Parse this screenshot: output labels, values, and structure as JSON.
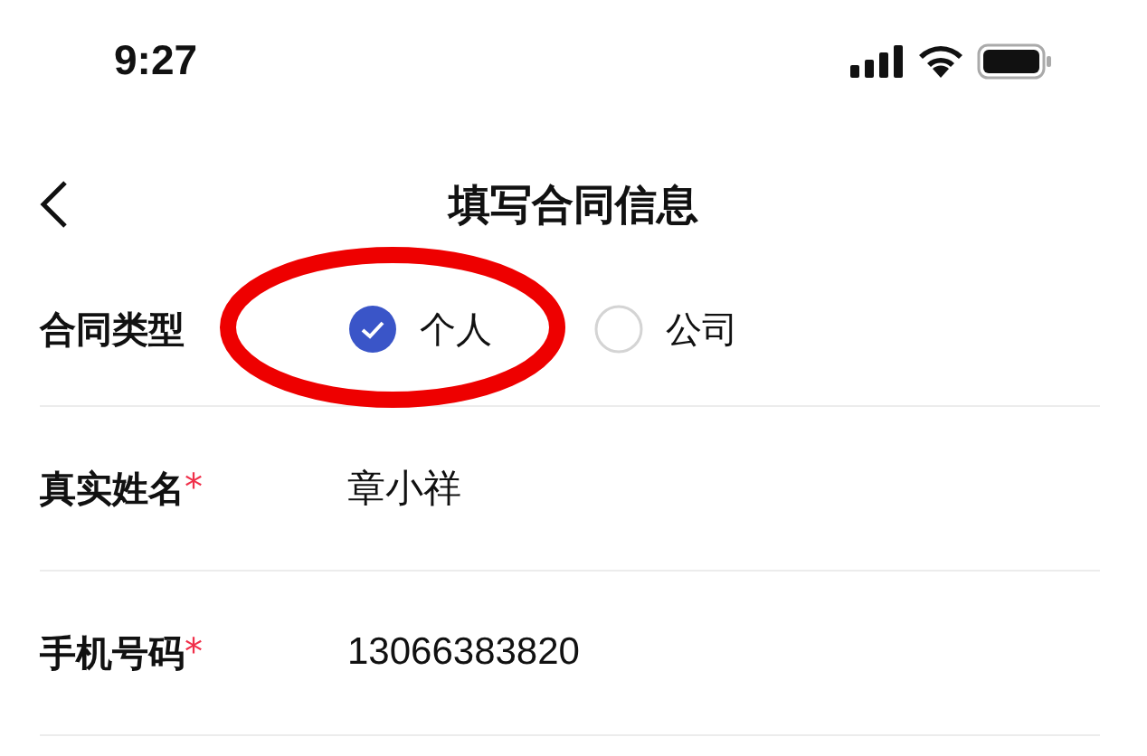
{
  "status_bar": {
    "time": "9:27"
  },
  "nav": {
    "title": "填写合同信息"
  },
  "form": {
    "type_field": {
      "label": "合同类型",
      "options": [
        {
          "label": "个人",
          "selected": true
        },
        {
          "label": "公司",
          "selected": false
        }
      ]
    },
    "fields": [
      {
        "label": "真实姓名",
        "required": true,
        "required_mark": "*",
        "value": "章小祥"
      },
      {
        "label": "手机号码",
        "required": true,
        "required_mark": "*",
        "value": "13066383820"
      }
    ]
  },
  "annotations": [
    {
      "kind": "ellipse"
    }
  ]
}
